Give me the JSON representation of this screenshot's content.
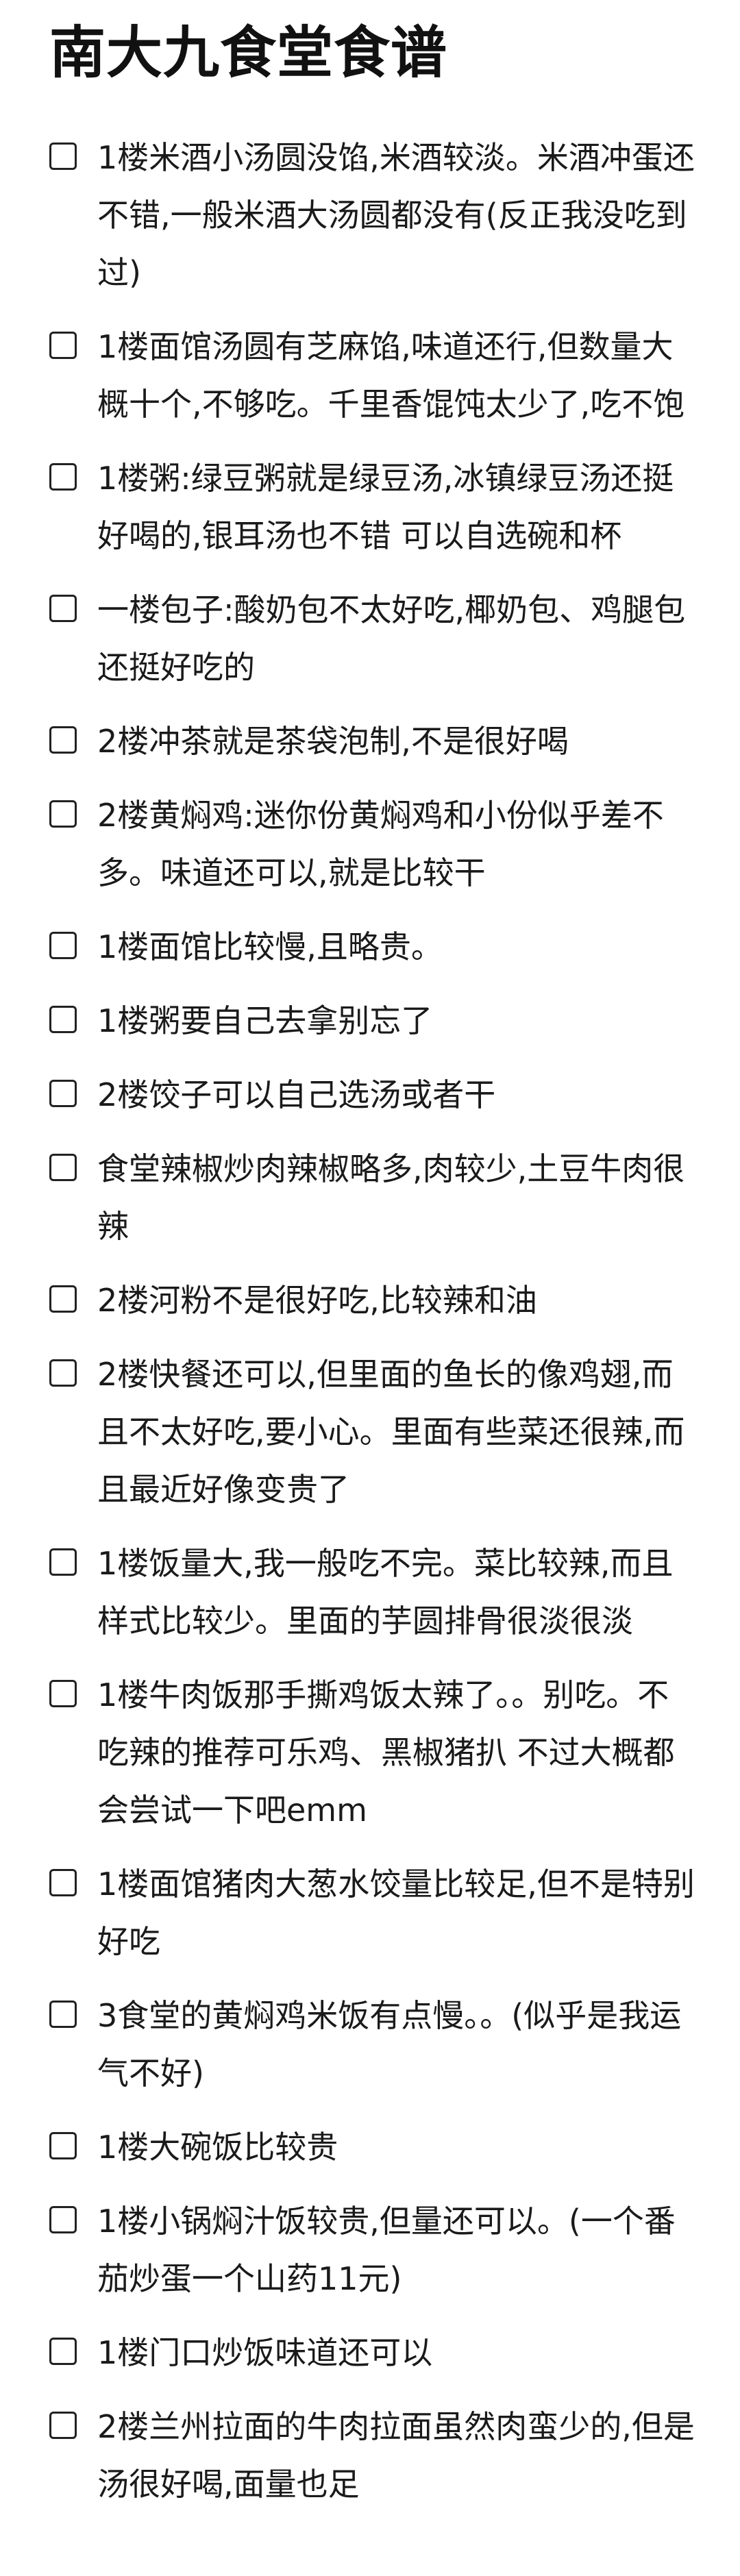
{
  "page": {
    "title": "南大九食堂食谱"
  },
  "checklist": {
    "items": [
      {
        "text": "1楼米酒小汤圆没馅,米酒较淡。米酒冲蛋还不错,一般米酒大汤圆都没有(反正我没吃到过)",
        "checked": false
      },
      {
        "text": "1楼面馆汤圆有芝麻馅,味道还行,但数量大概十个,不够吃。千里香馄饨太少了,吃不饱",
        "checked": false
      },
      {
        "text": "1楼粥:绿豆粥就是绿豆汤,冰镇绿豆汤还挺好喝的,银耳汤也不错 可以自选碗和杯",
        "checked": false
      },
      {
        "text": "一楼包子:酸奶包不太好吃,椰奶包、鸡腿包还挺好吃的",
        "checked": false
      },
      {
        "text": "2楼冲茶就是茶袋泡制,不是很好喝",
        "checked": false
      },
      {
        "text": "2楼黄焖鸡:迷你份黄焖鸡和小份似乎差不多。味道还可以,就是比较干",
        "checked": false
      },
      {
        "text": "1楼面馆比较慢,且略贵。",
        "checked": false
      },
      {
        "text": "1楼粥要自己去拿别忘了",
        "checked": false
      },
      {
        "text": "2楼饺子可以自己选汤或者干",
        "checked": false
      },
      {
        "text": "食堂辣椒炒肉辣椒略多,肉较少,土豆牛肉很辣",
        "checked": false
      },
      {
        "text": "2楼河粉不是很好吃,比较辣和油",
        "checked": false
      },
      {
        "text": "2楼快餐还可以,但里面的鱼长的像鸡翅,而且不太好吃,要小心。里面有些菜还很辣,而且最近好像变贵了",
        "checked": false
      },
      {
        "text": "1楼饭量大,我一般吃不完。菜比较辣,而且样式比较少。里面的芋圆排骨很淡很淡",
        "checked": false
      },
      {
        "text": "1楼牛肉饭那手撕鸡饭太辣了。。别吃。不吃辣的推荐可乐鸡、黑椒猪扒 不过大概都会尝试一下吧emm",
        "checked": false
      },
      {
        "text": "1楼面馆猪肉大葱水饺量比较足,但不是特别好吃",
        "checked": false
      },
      {
        "text": "3食堂的黄焖鸡米饭有点慢。。(似乎是我运气不好)",
        "checked": false
      },
      {
        "text": "1楼大碗饭比较贵",
        "checked": false
      },
      {
        "text": "1楼小锅焖汁饭较贵,但量还可以。(一个番茄炒蛋一个山药11元)",
        "checked": false
      },
      {
        "text": "1楼门口炒饭味道还可以",
        "checked": false
      },
      {
        "text": "2楼兰州拉面的牛肉拉面虽然肉蛮少的,但是汤很好喝,面量也足",
        "checked": false
      }
    ]
  }
}
